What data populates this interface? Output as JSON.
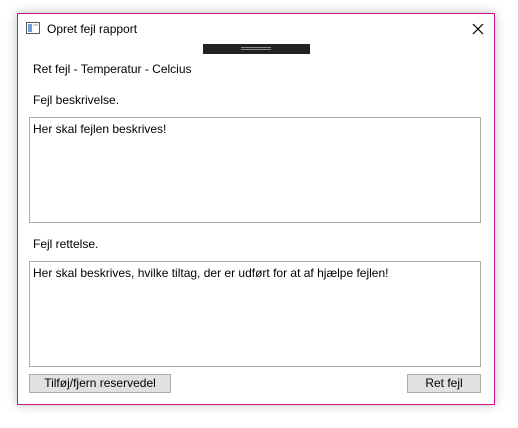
{
  "window": {
    "title": "Opret fejl rapport",
    "accent_border_color": "#c71585"
  },
  "content": {
    "heading": "Ret fejl - Temperatur - Celcius",
    "description_label": "Fejl beskrivelse.",
    "description_text": "Her skal fejlen beskrives!",
    "correction_label": "Fejl rettelse.",
    "correction_text": "Her skal beskrives, hvilke tiltag, der er udført for at af hjælpe fejlen!"
  },
  "buttons": {
    "spare_part": "Tilføj/fjern reservedel",
    "fix": "Ret fejl"
  },
  "icons": {
    "app": "window-icon",
    "close": "close-icon"
  }
}
